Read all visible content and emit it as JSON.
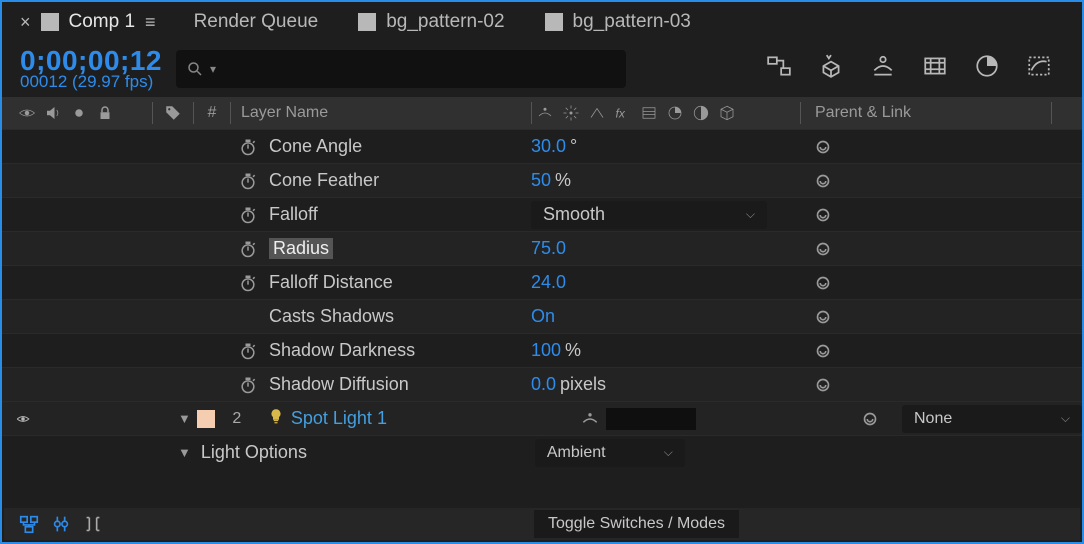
{
  "tabs": {
    "active": "Comp 1",
    "items": [
      "Render Queue",
      "bg_pattern-02",
      "bg_pattern-03"
    ]
  },
  "timecode": "0;00;00;12",
  "fps_line": "00012 (29.97 fps)",
  "search": {
    "placeholder": ""
  },
  "columns": {
    "hash": "#",
    "layer_name": "Layer Name",
    "parent_link": "Parent & Link"
  },
  "props": [
    {
      "name": "Cone Angle",
      "value": "30.0",
      "unit": "°",
      "stopwatch": true,
      "type": "num"
    },
    {
      "name": "Cone Feather",
      "value": "50",
      "unit": "%",
      "stopwatch": true,
      "type": "num"
    },
    {
      "name": "Falloff",
      "value": "Smooth",
      "unit": "",
      "stopwatch": true,
      "type": "select"
    },
    {
      "name": "Radius",
      "value": "75.0",
      "unit": "",
      "stopwatch": true,
      "type": "num",
      "selected": true
    },
    {
      "name": "Falloff Distance",
      "value": "24.0",
      "unit": "",
      "stopwatch": true,
      "type": "num"
    },
    {
      "name": "Casts Shadows",
      "value": "On",
      "unit": "",
      "stopwatch": false,
      "type": "num"
    },
    {
      "name": "Shadow Darkness",
      "value": "100",
      "unit": "%",
      "stopwatch": true,
      "type": "num"
    },
    {
      "name": "Shadow Diffusion",
      "value": "0.0",
      "unit": " pixels",
      "stopwatch": true,
      "type": "num"
    }
  ],
  "layer": {
    "index": "2",
    "name": "Spot Light 1",
    "parent": "None",
    "options_label": "Light Options",
    "light_type": "Ambient"
  },
  "footer": {
    "toggle": "Toggle Switches / Modes"
  }
}
